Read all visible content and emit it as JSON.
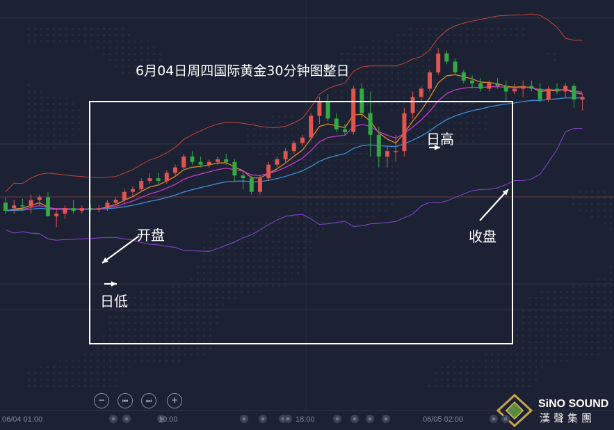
{
  "title": "6月04日周四国际黄金30分钟图整日",
  "annotations": {
    "open": "开盘",
    "low": "日低",
    "high": "日高",
    "close": "收盘"
  },
  "x_axis_labels": [
    "06/04 01:00",
    "10:00",
    "18:00",
    "06/05 02:00"
  ],
  "controls": [
    {
      "name": "zoom-out-button",
      "icon": "minus-icon",
      "glyph": "−"
    },
    {
      "name": "skip-back-button",
      "icon": "skip-back-icon",
      "glyph": "⏮"
    },
    {
      "name": "skip-forward-button",
      "icon": "skip-forward-icon",
      "glyph": "⏭"
    },
    {
      "name": "zoom-in-button",
      "icon": "plus-icon",
      "glyph": "+"
    }
  ],
  "logo": {
    "name": "SiNO SOUND",
    "subtitle": "漢聲集團"
  },
  "colors": {
    "bg": "#1c2233",
    "up": "#e0554e",
    "down": "#35a845",
    "bb": "#c4463a",
    "ma_blue": "#3f8fd6",
    "ma_orange": "#e08a2a",
    "ma_magenta": "#c93ac9",
    "bb_lower": "#8a45d8"
  },
  "chart_data": {
    "type": "candlestick",
    "timeframe": "30m",
    "candles": [
      [
        1,
        1.65,
        1.75,
        1.45,
        1.5
      ],
      [
        2,
        1.55,
        1.7,
        1.45,
        1.6
      ],
      [
        3,
        1.6,
        1.72,
        1.5,
        1.58
      ],
      [
        4,
        1.58,
        1.8,
        1.45,
        1.7
      ],
      [
        5,
        1.7,
        1.8,
        1.6,
        1.75
      ],
      [
        6,
        1.75,
        1.85,
        1.4,
        1.4
      ],
      [
        7,
        1.4,
        1.55,
        1.2,
        1.45
      ],
      [
        8,
        1.45,
        1.6,
        1.35,
        1.55
      ],
      [
        9,
        1.55,
        1.7,
        1.45,
        1.5
      ],
      [
        10,
        1.5,
        1.6,
        1.45,
        1.55
      ],
      [
        11,
        1.55,
        1.62,
        1.48,
        1.52
      ],
      [
        12,
        1.52,
        1.6,
        1.47,
        1.55
      ],
      [
        13,
        1.55,
        1.7,
        1.5,
        1.65
      ],
      [
        14,
        1.65,
        1.75,
        1.6,
        1.7
      ],
      [
        15,
        1.7,
        1.9,
        1.65,
        1.85
      ],
      [
        16,
        1.85,
        1.95,
        1.75,
        1.9
      ],
      [
        17,
        1.9,
        2.1,
        1.85,
        2.05
      ],
      [
        18,
        2.05,
        2.2,
        2.0,
        2.1
      ],
      [
        19,
        2.1,
        2.2,
        2.0,
        2.05
      ],
      [
        20,
        2.05,
        2.25,
        2.0,
        2.2
      ],
      [
        21,
        2.2,
        2.35,
        2.15,
        2.3
      ],
      [
        22,
        2.3,
        2.55,
        2.25,
        2.5
      ],
      [
        23,
        2.5,
        2.6,
        2.35,
        2.4
      ],
      [
        24,
        2.4,
        2.5,
        2.3,
        2.35
      ],
      [
        25,
        2.35,
        2.45,
        2.3,
        2.4
      ],
      [
        26,
        2.4,
        2.5,
        2.35,
        2.45
      ],
      [
        27,
        2.45,
        2.55,
        2.35,
        2.4
      ],
      [
        28,
        2.4,
        2.45,
        2.05,
        2.15
      ],
      [
        29,
        2.15,
        2.25,
        1.9,
        2.1
      ],
      [
        30,
        2.1,
        2.15,
        1.8,
        1.85
      ],
      [
        31,
        1.85,
        2.15,
        1.8,
        2.1
      ],
      [
        32,
        2.1,
        2.4,
        2.05,
        2.35
      ],
      [
        33,
        2.35,
        2.5,
        2.3,
        2.45
      ],
      [
        34,
        2.45,
        2.65,
        2.4,
        2.6
      ],
      [
        35,
        2.6,
        2.8,
        2.55,
        2.75
      ],
      [
        36,
        2.75,
        2.9,
        2.7,
        2.85
      ],
      [
        37,
        2.85,
        3.3,
        2.8,
        3.25
      ],
      [
        38,
        3.25,
        3.6,
        3.1,
        3.5
      ],
      [
        39,
        3.5,
        3.65,
        3.15,
        3.2
      ],
      [
        40,
        3.2,
        3.3,
        2.95,
        3.0
      ],
      [
        41,
        3.0,
        3.1,
        2.9,
        2.95
      ],
      [
        42,
        2.95,
        3.8,
        2.9,
        3.75
      ],
      [
        43,
        3.75,
        3.85,
        3.2,
        3.3
      ],
      [
        44,
        3.3,
        3.7,
        2.5,
        2.9
      ],
      [
        45,
        2.9,
        3.05,
        2.3,
        2.5
      ],
      [
        46,
        2.5,
        2.7,
        2.3,
        2.6
      ],
      [
        47,
        2.6,
        2.9,
        2.4,
        2.6
      ],
      [
        48,
        2.6,
        3.4,
        2.5,
        3.3
      ],
      [
        49,
        3.3,
        3.7,
        3.2,
        3.6
      ],
      [
        50,
        3.6,
        3.8,
        3.5,
        3.75
      ],
      [
        51,
        3.75,
        4.1,
        3.7,
        4.05
      ],
      [
        52,
        4.05,
        4.5,
        4.0,
        4.4
      ],
      [
        53,
        4.4,
        4.45,
        4.2,
        4.25
      ],
      [
        54,
        4.25,
        4.3,
        4.0,
        4.05
      ],
      [
        55,
        4.05,
        4.1,
        3.85,
        3.9
      ],
      [
        56,
        3.9,
        4.0,
        3.75,
        3.85
      ],
      [
        57,
        3.85,
        3.95,
        3.7,
        3.75
      ],
      [
        58,
        3.75,
        3.9,
        3.7,
        3.85
      ],
      [
        59,
        3.85,
        3.95,
        3.75,
        3.8
      ],
      [
        60,
        3.8,
        3.9,
        3.5,
        3.7
      ],
      [
        61,
        3.7,
        3.85,
        3.65,
        3.75
      ],
      [
        62,
        3.75,
        3.9,
        3.6,
        3.8
      ],
      [
        63,
        3.8,
        3.9,
        3.7,
        3.75
      ],
      [
        64,
        3.75,
        3.85,
        3.5,
        3.55
      ],
      [
        65,
        3.55,
        3.8,
        3.5,
        3.75
      ],
      [
        66,
        3.75,
        3.85,
        3.65,
        3.7
      ],
      [
        67,
        3.7,
        3.85,
        3.6,
        3.8
      ],
      [
        68,
        3.8,
        3.85,
        3.4,
        3.55
      ],
      [
        69,
        3.55,
        3.65,
        3.35,
        3.6
      ]
    ]
  }
}
